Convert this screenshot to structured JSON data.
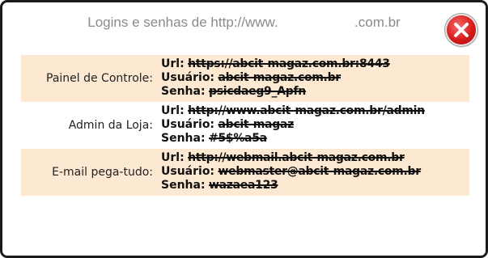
{
  "dialog": {
    "title": "Logins e senhas de http://www.                    .com.br",
    "close_icon": "close-icon",
    "close_color": "#d81b1b"
  },
  "rows": [
    {
      "label": "Painel de Controle:",
      "url_key": "Url:",
      "url_value": "https://abcit-magaz.com.br:8443",
      "user_key": "Usuário:",
      "user_value": "abcit-magaz.com.br",
      "pass_key": "Senha:",
      "pass_value": "psicdaeg9_Apfn"
    },
    {
      "label": "Admin da Loja:",
      "url_key": "Url:",
      "url_value": "http://www.abcit-magaz.com.br/admin",
      "user_key": "Usuário:",
      "user_value": "abcit-magaz",
      "pass_key": "Senha:",
      "pass_value": "#5$%a5a"
    },
    {
      "label": "E-mail pega-tudo:",
      "url_key": "Url:",
      "url_value": "http://webmail.abcit-magaz.com.br",
      "user_key": "Usuário:",
      "user_value": "webmaster@abcit-magaz.com.br",
      "pass_key": "Senha:",
      "pass_value": "wazaea123"
    }
  ]
}
